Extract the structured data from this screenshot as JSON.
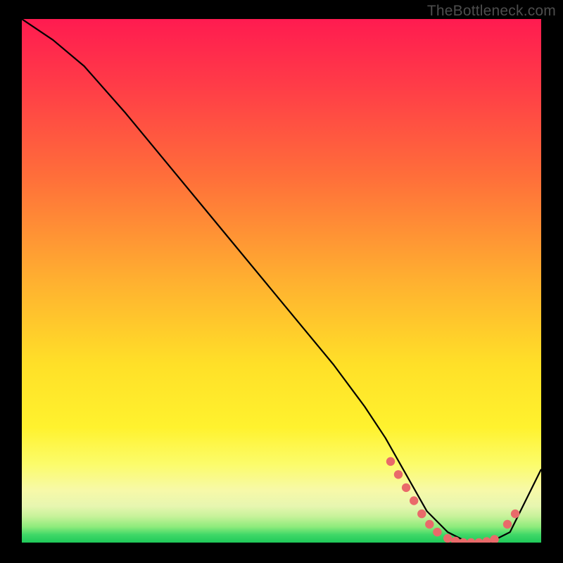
{
  "watermark": "TheBottleneck.com",
  "chart_data": {
    "type": "line",
    "title": "",
    "xlabel": "",
    "ylabel": "",
    "xlim": [
      0,
      100
    ],
    "ylim": [
      0,
      100
    ],
    "series": [
      {
        "name": "curve",
        "x": [
          0,
          6,
          12,
          20,
          30,
          40,
          50,
          60,
          66,
          70,
          74,
          78,
          82,
          86,
          90,
          94,
          100
        ],
        "y": [
          100,
          96,
          91,
          82,
          70,
          58,
          46,
          34,
          26,
          20,
          13,
          6,
          2,
          0,
          0,
          2,
          14
        ]
      }
    ],
    "markers": {
      "name": "dots",
      "color": "#e96a6a",
      "points": [
        {
          "x": 71,
          "y": 15.5
        },
        {
          "x": 72.5,
          "y": 13
        },
        {
          "x": 74,
          "y": 10.5
        },
        {
          "x": 75.5,
          "y": 8
        },
        {
          "x": 77,
          "y": 5.5
        },
        {
          "x": 78.5,
          "y": 3.5
        },
        {
          "x": 80,
          "y": 2
        },
        {
          "x": 82,
          "y": 0.8
        },
        {
          "x": 83.5,
          "y": 0.3
        },
        {
          "x": 85,
          "y": 0
        },
        {
          "x": 86.5,
          "y": 0
        },
        {
          "x": 88,
          "y": 0
        },
        {
          "x": 89.5,
          "y": 0.2
        },
        {
          "x": 91,
          "y": 0.6
        },
        {
          "x": 93.5,
          "y": 3.5
        },
        {
          "x": 95,
          "y": 5.5
        }
      ]
    },
    "gradient_stops": [
      {
        "pos": 0,
        "color": "#ff1b50"
      },
      {
        "pos": 0.5,
        "color": "#ffb030"
      },
      {
        "pos": 0.78,
        "color": "#fff22e"
      },
      {
        "pos": 0.95,
        "color": "#c7f29a"
      },
      {
        "pos": 1.0,
        "color": "#1fc95a"
      }
    ]
  }
}
